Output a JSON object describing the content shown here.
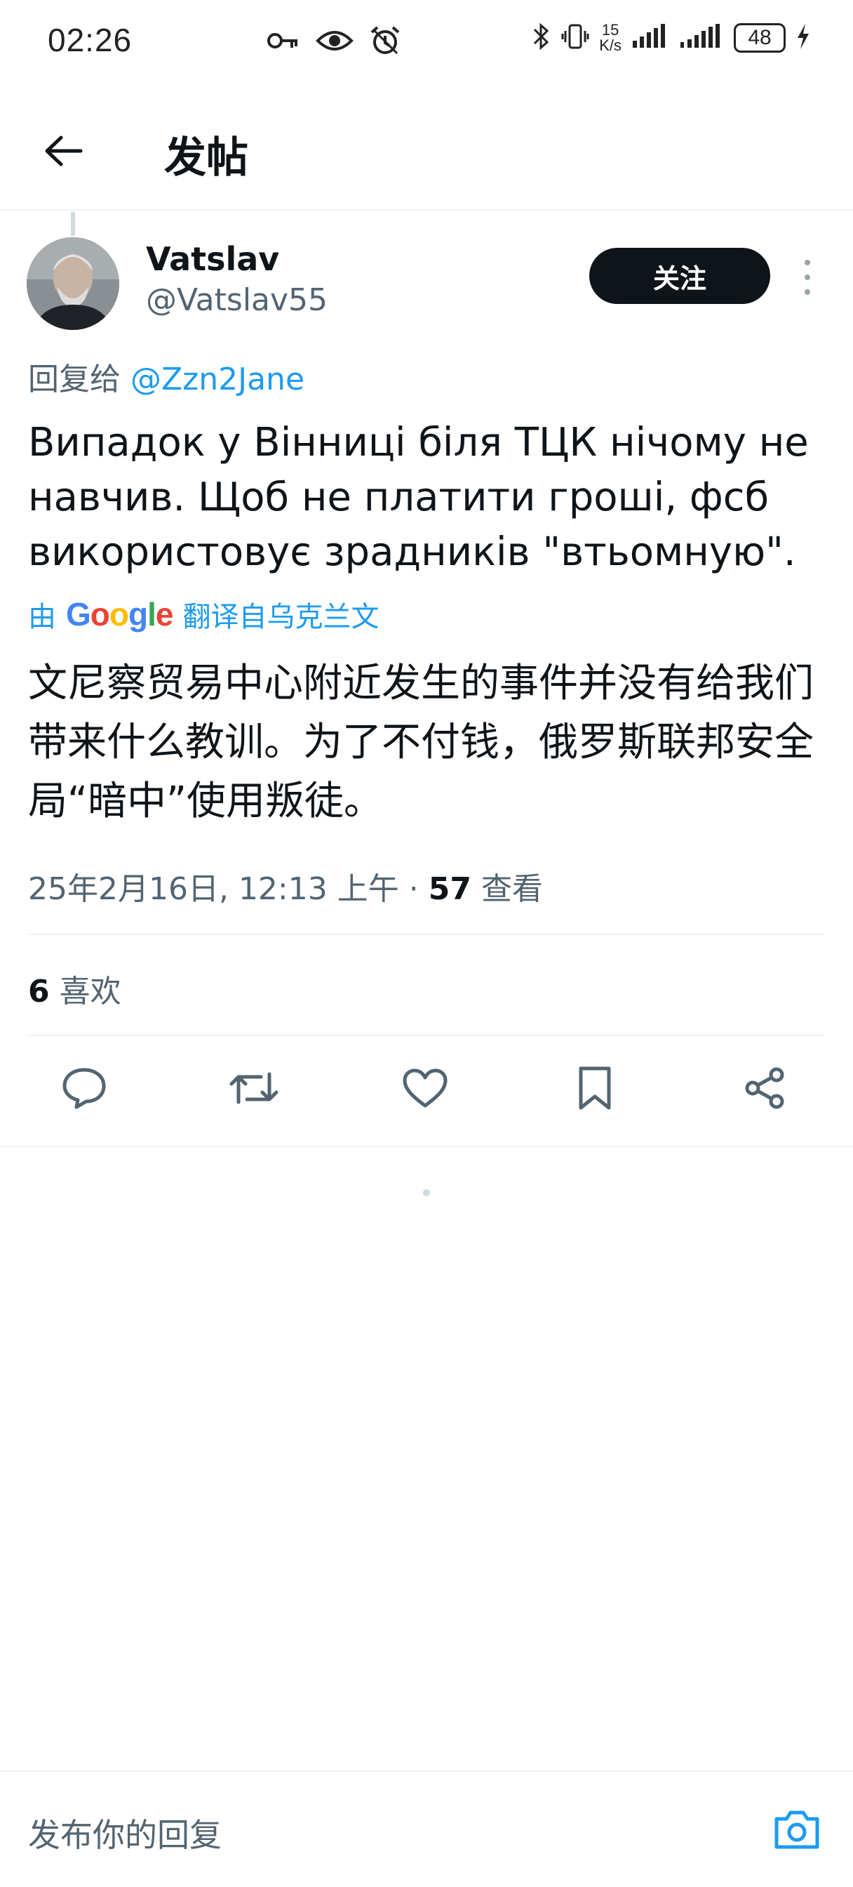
{
  "status_bar": {
    "time": "02:26",
    "speed_value": "15",
    "speed_unit": "K/s",
    "battery": "48",
    "icons": [
      "key-icon",
      "eye-icon",
      "alarm-icon",
      "bluetooth-icon",
      "vibrate-icon",
      "signal-icon",
      "signal-icon",
      "charging-icon"
    ]
  },
  "header": {
    "title": "发帖"
  },
  "tweet": {
    "author_name": "Vatslav",
    "author_handle": "@Vatslav55",
    "follow_label": "关注",
    "reply_prefix": "回复给",
    "reply_mention": "@Zzn2Jane",
    "text": "Випадок у Вінниці біля ТЦК нічому не навчив. Щоб не платити гроші, фсб використовує зрадників \"втьомную\".",
    "translate_by": "由",
    "translate_google": "Google",
    "translate_suffix": "翻译自乌克兰文",
    "translated_text": "文尼察贸易中心附近发生的事件并没有给我们带来什么教训。为了不付钱，俄罗斯联邦安全局“暗中”使用叛徒。",
    "timestamp": "25年2月16日, 12:13 上午",
    "separator": "·",
    "views_count": "57",
    "views_label": "查看",
    "likes_count": "6",
    "likes_label": "喜欢"
  },
  "actions": [
    "reply-icon",
    "retweet-icon",
    "like-icon",
    "bookmark-icon",
    "share-icon"
  ],
  "reply_bar": {
    "placeholder": "发布你的回复"
  },
  "colors": {
    "accent": "#1d9bf0",
    "text": "#0f1419",
    "secondary": "#536471",
    "divider": "#eff3f4"
  }
}
